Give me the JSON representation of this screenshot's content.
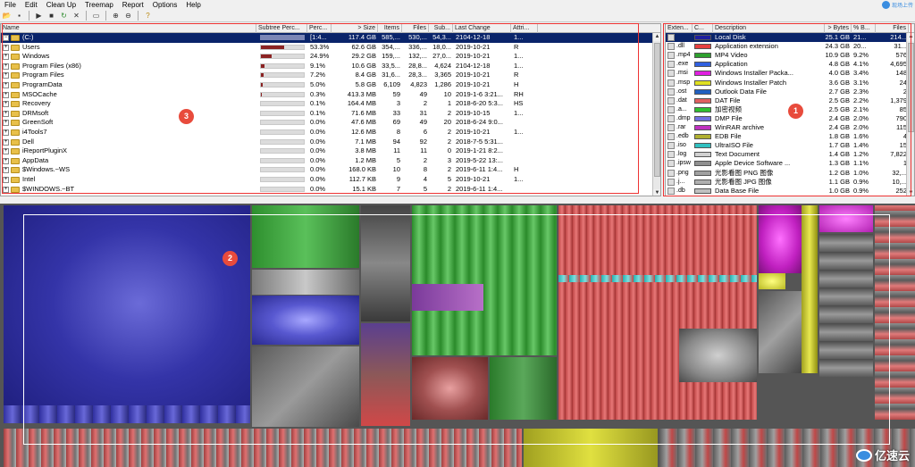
{
  "menu": [
    "File",
    "Edit",
    "Clean Up",
    "Treemap",
    "Report",
    "Options",
    "Help"
  ],
  "toolbar_icons": [
    "open-icon",
    "save-icon",
    "play-icon",
    "stop-icon",
    "refresh-icon",
    "delete-icon",
    "folder-icon",
    "zoom-in-icon",
    "zoom-out-icon",
    "help-icon"
  ],
  "corner": {
    "label": "现场上传"
  },
  "left_headers": [
    "Name",
    "Subtree Perc...",
    "Perc...",
    "> Size",
    "Items",
    "Files",
    "Sub...",
    "Last Change",
    "Attri..."
  ],
  "left_rows": [
    {
      "name": "(C:)",
      "bar": 1.0,
      "perc": "[1:4...",
      "size": "117.4 GB",
      "items": "585,...",
      "files": "530,...",
      "sub": "54,3...",
      "date": "2104-12-18",
      "attr": "1...",
      "selected": true,
      "sign": "−"
    },
    {
      "name": "Users",
      "bar": 0.533,
      "perc": "53.3%",
      "size": "62.6 GB",
      "items": "354,...",
      "files": "336,...",
      "sub": "18,0...",
      "date": "2019-10-21",
      "attr": "R",
      "sign": "+"
    },
    {
      "name": "Windows",
      "bar": 0.249,
      "perc": "24.9%",
      "size": "29.2 GB",
      "items": "159,...",
      "files": "132,...",
      "sub": "27,0...",
      "date": "2019-10-21",
      "attr": "1...",
      "sign": "+"
    },
    {
      "name": "Program Files (x86)",
      "bar": 0.091,
      "perc": "9.1%",
      "size": "10.6 GB",
      "items": "33,5...",
      "files": "28,8...",
      "sub": "4,624",
      "date": "2104-12-18",
      "attr": "1...",
      "sign": "+"
    },
    {
      "name": "Program Files",
      "bar": 0.072,
      "perc": "7.2%",
      "size": "8.4 GB",
      "items": "31,6...",
      "files": "28,3...",
      "sub": "3,365",
      "date": "2019-10-21",
      "attr": "R",
      "sign": "+"
    },
    {
      "name": "ProgramData",
      "bar": 0.05,
      "perc": "5.0%",
      "size": "5.8 GB",
      "items": "6,109",
      "files": "4,823",
      "sub": "1,286",
      "date": "2019-10-21",
      "attr": "H",
      "sign": "+"
    },
    {
      "name": "MSOCache",
      "bar": 0.003,
      "perc": "0.3%",
      "size": "413.3 MB",
      "items": "59",
      "files": "49",
      "sub": "10",
      "date": "2019-1-6  3:21...",
      "attr": "RH",
      "sign": "+"
    },
    {
      "name": "Recovery",
      "bar": 0.001,
      "perc": "0.1%",
      "size": "164.4 MB",
      "items": "3",
      "files": "2",
      "sub": "1",
      "date": "2018-6-20  5:3...",
      "attr": "HS",
      "sign": "+"
    },
    {
      "name": "DRMsoft",
      "bar": 0.001,
      "perc": "0.1%",
      "size": "71.6 MB",
      "items": "33",
      "files": "31",
      "sub": "2",
      "date": "2019-10-15",
      "attr": "1...",
      "sign": "+"
    },
    {
      "name": "GreenSoft",
      "bar": 0.0,
      "perc": "0.0%",
      "size": "47.6 MB",
      "items": "69",
      "files": "49",
      "sub": "20",
      "date": "2018-6-24  9:0...",
      "attr": "",
      "sign": "+"
    },
    {
      "name": "i4Tools7",
      "bar": 0.0,
      "perc": "0.0%",
      "size": "12.6 MB",
      "items": "8",
      "files": "6",
      "sub": "2",
      "date": "2019-10-21",
      "attr": "1...",
      "sign": "+"
    },
    {
      "name": "Dell",
      "bar": 0.0,
      "perc": "0.0%",
      "size": "7.1 MB",
      "items": "94",
      "files": "92",
      "sub": "2",
      "date": "2018-7-5  5:31...",
      "attr": "",
      "sign": "+"
    },
    {
      "name": "iReportPluginX",
      "bar": 0.0,
      "perc": "0.0%",
      "size": "3.8 MB",
      "items": "11",
      "files": "11",
      "sub": "0",
      "date": "2019-1-21  8:2...",
      "attr": "",
      "sign": "+"
    },
    {
      "name": "AppData",
      "bar": 0.0,
      "perc": "0.0%",
      "size": "1.2 MB",
      "items": "5",
      "files": "2",
      "sub": "3",
      "date": "2019-5-22  13:...",
      "attr": "",
      "sign": "+"
    },
    {
      "name": "$Windows.~WS",
      "bar": 0.0,
      "perc": "0.0%",
      "size": "168.0 KB",
      "items": "10",
      "files": "8",
      "sub": "2",
      "date": "2019-6-11  1:4...",
      "attr": "H",
      "sign": "+"
    },
    {
      "name": "Intel",
      "bar": 0.0,
      "perc": "0.0%",
      "size": "112.7 KB",
      "items": "9",
      "files": "4",
      "sub": "5",
      "date": "2019-10-21",
      "attr": "1...",
      "sign": "+"
    },
    {
      "name": "$WINDOWS.~BT",
      "bar": 0.0,
      "perc": "0.0%",
      "size": "15.1 KB",
      "items": "7",
      "files": "5",
      "sub": "2",
      "date": "2019-6-11  1:4...",
      "attr": "",
      "sign": "+"
    }
  ],
  "right_headers": [
    "Exten...",
    "C...",
    "Description",
    "> Bytes",
    "% B...",
    "Files"
  ],
  "right_rows": [
    {
      "ext": "",
      "color": "#1e1e9e",
      "desc": "Local Disk",
      "bytes": "25.1 GB",
      "pct": "21...",
      "files": "214...",
      "selected": true
    },
    {
      "ext": ".dll",
      "color": "#e64040",
      "desc": "Application extension",
      "bytes": "24.3 GB",
      "pct": "20...",
      "files": "31..."
    },
    {
      "ext": ".mp4",
      "color": "#2ea02e",
      "desc": "MP4 Video",
      "bytes": "10.9 GB",
      "pct": "9.2%",
      "files": "576"
    },
    {
      "ext": ".exe",
      "color": "#3060e0",
      "desc": "Application",
      "bytes": "4.8 GB",
      "pct": "4.1%",
      "files": "4,695"
    },
    {
      "ext": ".msi",
      "color": "#e020e0",
      "desc": "Windows Installer Packa...",
      "bytes": "4.0 GB",
      "pct": "3.4%",
      "files": "148"
    },
    {
      "ext": ".msp",
      "color": "#e0e020",
      "desc": "Windows Installer Patch",
      "bytes": "3.6 GB",
      "pct": "3.1%",
      "files": "24"
    },
    {
      "ext": ".ost",
      "color": "#2060c0",
      "desc": "Outlook Data File",
      "bytes": "2.7 GB",
      "pct": "2.3%",
      "files": "2"
    },
    {
      "ext": ".dat",
      "color": "#e06060",
      "desc": "DAT File",
      "bytes": "2.5 GB",
      "pct": "2.2%",
      "files": "1,379"
    },
    {
      "ext": ".a...",
      "color": "#30c030",
      "desc": "加密视频",
      "bytes": "2.5 GB",
      "pct": "2.1%",
      "files": "85"
    },
    {
      "ext": ".dmp",
      "color": "#7070e0",
      "desc": "DMP File",
      "bytes": "2.4 GB",
      "pct": "2.0%",
      "files": "790"
    },
    {
      "ext": ".rar",
      "color": "#c030c0",
      "desc": "WinRAR archive",
      "bytes": "2.4 GB",
      "pct": "2.0%",
      "files": "115"
    },
    {
      "ext": ".edb",
      "color": "#b0b030",
      "desc": "EDB File",
      "bytes": "1.8 GB",
      "pct": "1.6%",
      "files": "4"
    },
    {
      "ext": ".iso",
      "color": "#30c0c0",
      "desc": "UltraISO File",
      "bytes": "1.7 GB",
      "pct": "1.4%",
      "files": "15"
    },
    {
      "ext": ".log",
      "color": "#d0d0d0",
      "desc": "Text Document",
      "bytes": "1.4 GB",
      "pct": "1.2%",
      "files": "7,822"
    },
    {
      "ext": ".ipsw",
      "color": "#909090",
      "desc": "Apple Device Software ...",
      "bytes": "1.3 GB",
      "pct": "1.1%",
      "files": "1"
    },
    {
      "ext": ".png",
      "color": "#a0a0a0",
      "desc": "光影看图 PNG 图像",
      "bytes": "1.2 GB",
      "pct": "1.0%",
      "files": "32,..."
    },
    {
      "ext": ".j...",
      "color": "#b0b0b0",
      "desc": "光影看图 JPG 图像",
      "bytes": "1.1 GB",
      "pct": "0.9%",
      "files": "10,..."
    },
    {
      "ext": ".db",
      "color": "#c0c0c0",
      "desc": "Data Base File",
      "bytes": "1.0 GB",
      "pct": "0.9%",
      "files": "252"
    }
  ],
  "badges": {
    "one": "1",
    "two": "2",
    "three": "3"
  },
  "watermark": {
    "text": "亿速云"
  }
}
